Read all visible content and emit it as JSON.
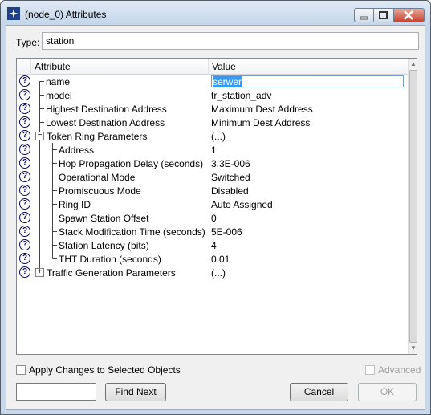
{
  "window": {
    "title": "(node_0) Attributes",
    "app_icon": "opnet-star-icon",
    "controls": [
      "minimize-icon",
      "maximize-icon",
      "close-icon"
    ]
  },
  "type": {
    "label": "Type:",
    "value": "station"
  },
  "grid": {
    "columns": [
      "Attribute",
      "Value"
    ],
    "rows": [
      {
        "name": "name",
        "value": "serwer",
        "selected": true,
        "level": 0,
        "expander": ""
      },
      {
        "name": "model",
        "value": "tr_station_adv",
        "level": 0,
        "expander": ""
      },
      {
        "name": "Highest Destination Address",
        "value": "Maximum Dest Address",
        "level": 0,
        "expander": ""
      },
      {
        "name": "Lowest Destination Address",
        "value": "Minimum Dest Address",
        "level": 0,
        "expander": ""
      },
      {
        "name": "Token Ring Parameters",
        "value": "(...)",
        "level": 0,
        "expander": "−"
      },
      {
        "name": "Address",
        "value": "1",
        "level": 1,
        "expander": ""
      },
      {
        "name": "Hop Propagation Delay (seconds)",
        "value": "3.3E-006",
        "level": 1,
        "expander": ""
      },
      {
        "name": "Operational Mode",
        "value": "Switched",
        "level": 1,
        "expander": ""
      },
      {
        "name": "Promiscuous Mode",
        "value": "Disabled",
        "level": 1,
        "expander": ""
      },
      {
        "name": "Ring ID",
        "value": "Auto Assigned",
        "level": 1,
        "expander": ""
      },
      {
        "name": "Spawn Station Offset",
        "value": "0",
        "level": 1,
        "expander": ""
      },
      {
        "name": "Stack Modification Time (seconds)",
        "value": "5E-006",
        "level": 1,
        "expander": ""
      },
      {
        "name": "Station Latency (bits)",
        "value": "4",
        "level": 1,
        "expander": ""
      },
      {
        "name": "THT Duration (seconds)",
        "value": "0.01",
        "level": 1,
        "expander": ""
      },
      {
        "name": "Traffic Generation Parameters",
        "value": "(...)",
        "level": 0,
        "expander": "+"
      }
    ]
  },
  "footer": {
    "apply_changes_label": "Apply Changes to Selected Objects",
    "advanced_label": "Advanced",
    "find_value": "",
    "find_next_label": "Find Next",
    "cancel_label": "Cancel",
    "ok_label": "OK"
  }
}
